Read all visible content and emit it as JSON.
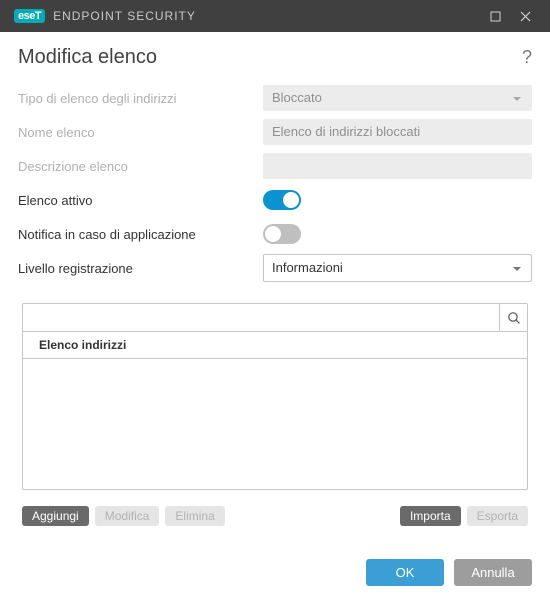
{
  "titlebar": {
    "brand_logo": "eseT",
    "app_name": "ENDPOINT SECURITY"
  },
  "header": {
    "title": "Modifica elenco"
  },
  "form": {
    "type_label": "Tipo di elenco degli indirizzi",
    "type_value": "Bloccato",
    "name_label": "Nome elenco",
    "name_value": "Elenco di indirizzi bloccati",
    "description_label": "Descrizione elenco",
    "description_value": "",
    "active_label": "Elenco attivo",
    "active_on": true,
    "notify_label": "Notifica in caso di applicazione",
    "notify_on": false,
    "loglevel_label": "Livello registrazione",
    "loglevel_value": "Informazioni"
  },
  "list": {
    "search_placeholder": "",
    "header": "Elenco indirizzi",
    "buttons": {
      "add": "Aggiungi",
      "edit": "Modifica",
      "delete": "Elimina",
      "import": "Importa",
      "export": "Esporta"
    }
  },
  "footer": {
    "ok": "OK",
    "cancel": "Annulla"
  }
}
